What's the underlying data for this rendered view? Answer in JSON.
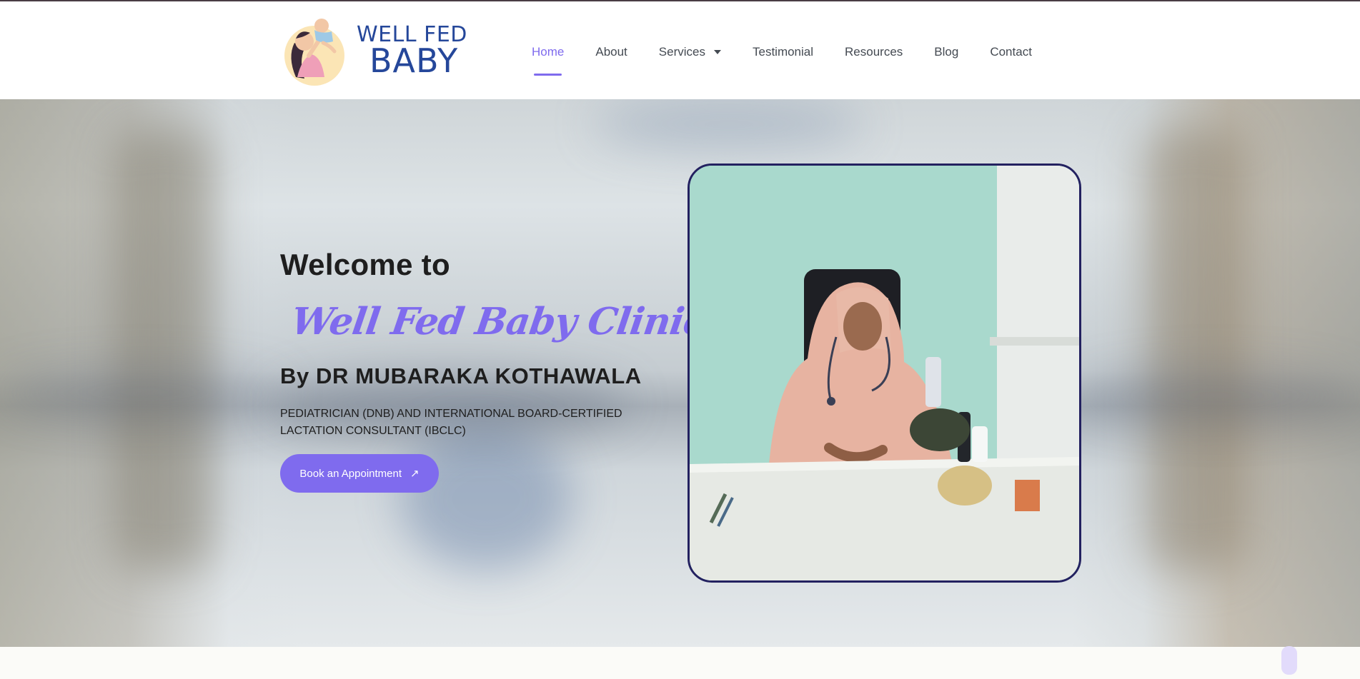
{
  "brand": {
    "line1": "WELL FED",
    "line2": "BABY",
    "color": "#25479a"
  },
  "nav": {
    "items": [
      {
        "label": "Home",
        "active": true
      },
      {
        "label": "About"
      },
      {
        "label": "Services",
        "has_dropdown": true
      },
      {
        "label": "Testimonial"
      },
      {
        "label": "Resources"
      },
      {
        "label": "Blog"
      },
      {
        "label": "Contact"
      }
    ],
    "active_color": "#7f6bee"
  },
  "hero": {
    "welcome": "Welcome to",
    "clinic_name": "Well Fed Baby Clinic",
    "byline": "By DR MUBARAKA KOTHAWALA",
    "credentials": "PEDIATRICIAN (DNB) AND INTERNATIONAL BOARD-CERTIFIED LACTATION CONSULTANT (IBCLC)",
    "cta_label": "Book an Appointment",
    "cta_icon": "arrow-up-right-icon",
    "accent_color": "#7f6bee"
  }
}
